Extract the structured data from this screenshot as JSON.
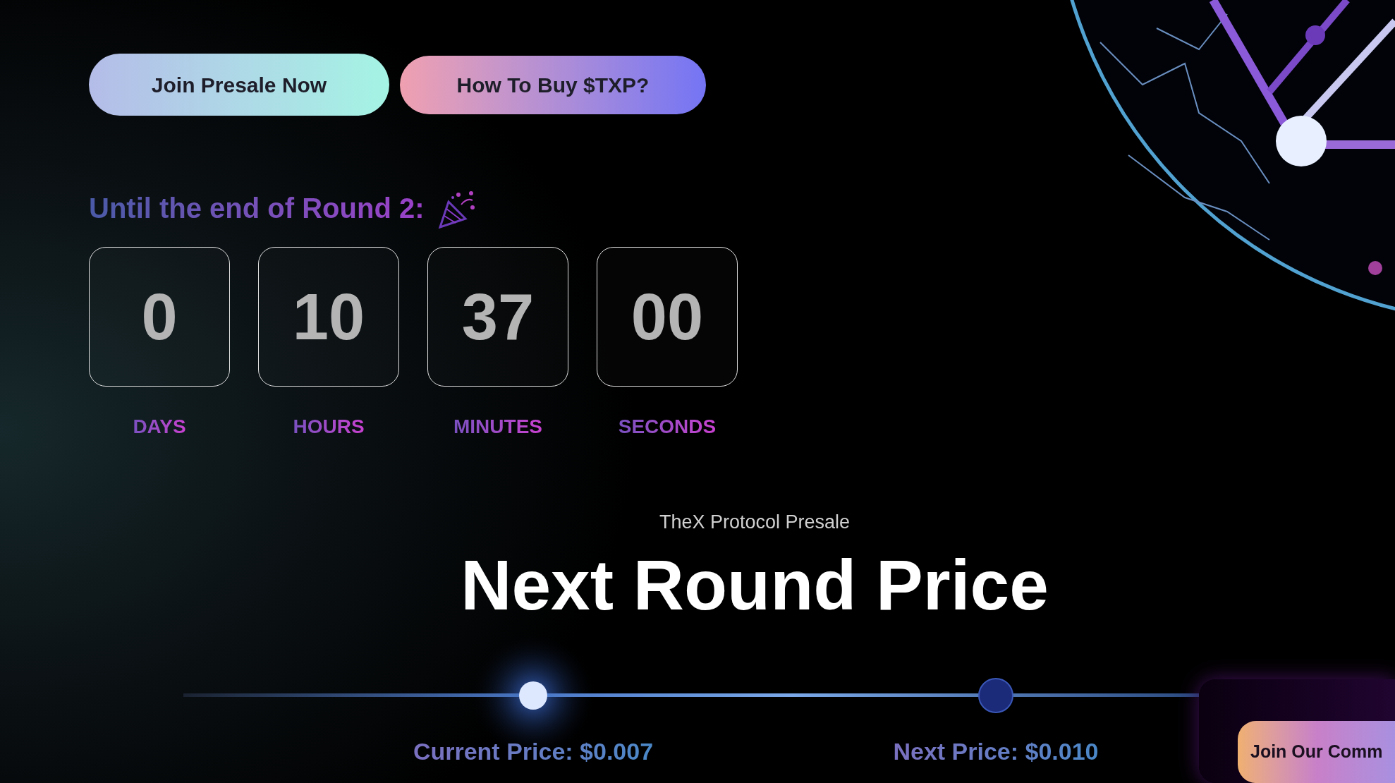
{
  "buttons": [
    {
      "label": "Join Presale Now",
      "kind": "mint"
    },
    {
      "label": "How To Buy $TXP?",
      "kind": "violet"
    }
  ],
  "countdown": {
    "title": "Until the end of Round 2:",
    "units": [
      {
        "value": "0",
        "label": "DAYS"
      },
      {
        "value": "10",
        "label": "HOURS"
      },
      {
        "value": "37",
        "label": "MINUTES"
      },
      {
        "value": "00",
        "label": "SECONDS"
      }
    ]
  },
  "presale": {
    "subtitle": "TheX Protocol Presale",
    "title": "Next Round Price",
    "current_price": "Current Price: $0.007",
    "next_price": "Next Price: $0.010"
  },
  "community_button": {
    "label": "Join Our Comm"
  }
}
